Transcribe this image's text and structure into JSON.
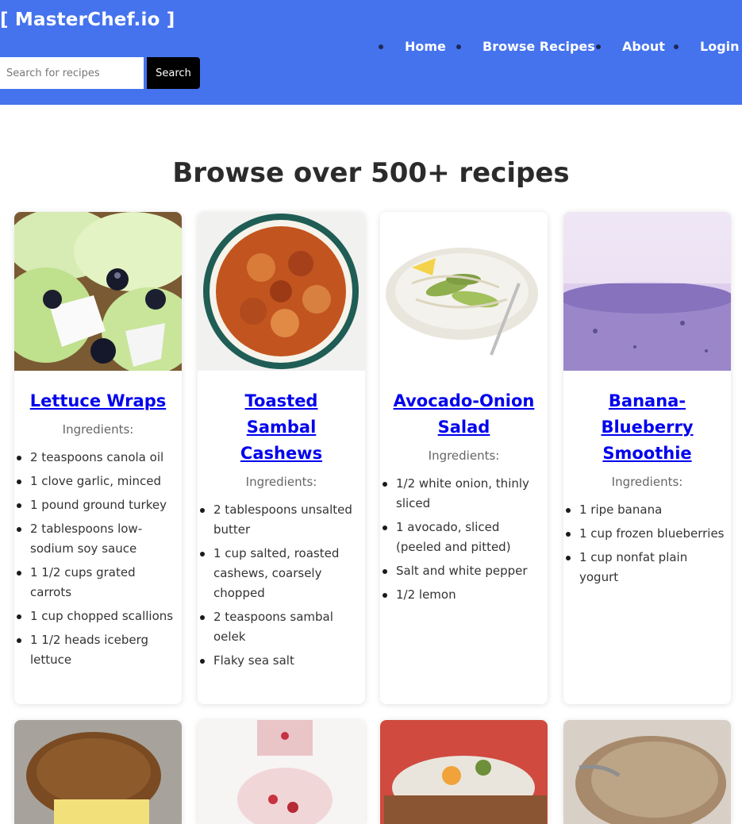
{
  "header": {
    "brand": "[ MasterChef.io ]",
    "search_placeholder": "Search for recipes",
    "search_button": "Search",
    "nav": [
      "Home",
      "Browse Recipes",
      "About",
      "Login"
    ]
  },
  "heading": "Browse over 500+ recipes",
  "ingredients_label": "Ingredients:",
  "recipes": [
    {
      "title": "Lettuce Wraps",
      "ingredients": [
        "2 teaspoons canola oil",
        "1 clove garlic, minced",
        "1 pound ground turkey",
        "2 tablespoons low-sodium soy sauce",
        "1 1/2 cups grated carrots",
        "1 cup chopped scallions",
        "1 1/2 heads iceberg lettuce"
      ]
    },
    {
      "title": "Toasted Sambal Cashews",
      "ingredients": [
        "2 tablespoons unsalted butter",
        "1 cup salted, roasted cashews, coarsely chopped",
        "2 teaspoons sambal oelek",
        "Flaky sea salt"
      ]
    },
    {
      "title": "Avocado-Onion Salad",
      "ingredients": [
        "1/2 white onion, thinly sliced",
        "1 avocado, sliced (peeled and pitted)",
        "Salt and white pepper",
        "1/2 lemon"
      ]
    },
    {
      "title": "Banana-Blueberry Smoothie",
      "ingredients": [
        "1 ripe banana",
        "1 cup frozen blueberries",
        "1 cup nonfat plain yogurt"
      ]
    }
  ],
  "colors": {
    "header_bg": "#4573ee",
    "link": "#0000ee",
    "search_button_bg": "#000000"
  }
}
